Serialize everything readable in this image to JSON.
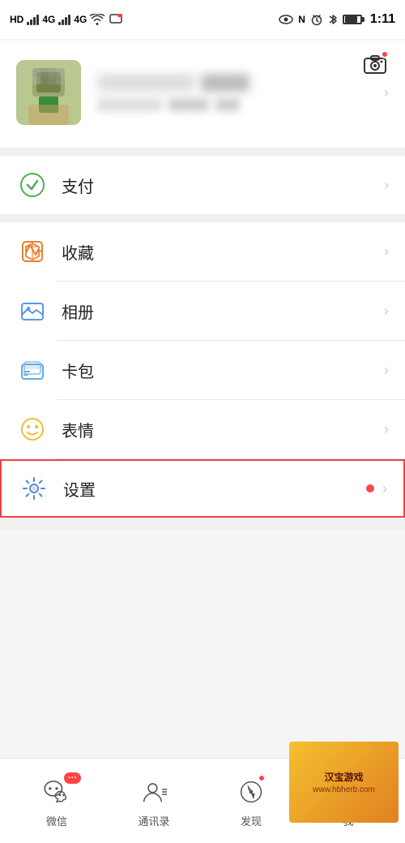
{
  "statusBar": {
    "network": "HD 4G",
    "signal1": "46",
    "signal2": "46",
    "time": "1:11",
    "icons": [
      "eye",
      "notification",
      "alarm",
      "bluetooth",
      "battery"
    ]
  },
  "profile": {
    "cameraLabel": "相机",
    "nameBlurred": true
  },
  "menuItems": [
    {
      "id": "payment",
      "label": "支付",
      "iconType": "payment",
      "highlighted": false,
      "badge": false
    },
    {
      "id": "favorites",
      "label": "收藏",
      "iconType": "favorites",
      "highlighted": false,
      "badge": false
    },
    {
      "id": "photos",
      "label": "相册",
      "iconType": "photos",
      "highlighted": false,
      "badge": false
    },
    {
      "id": "cards",
      "label": "卡包",
      "iconType": "cards",
      "highlighted": false,
      "badge": false
    },
    {
      "id": "emoji",
      "label": "表情",
      "iconType": "emoji",
      "highlighted": false,
      "badge": false
    },
    {
      "id": "settings",
      "label": "设置",
      "iconType": "settings",
      "highlighted": true,
      "badge": true
    }
  ],
  "bottomNav": [
    {
      "id": "wechat",
      "label": "微信",
      "iconType": "wechat",
      "dotType": "ellipsis"
    },
    {
      "id": "contacts",
      "label": "通讯录",
      "iconType": "contacts",
      "dotType": "none"
    },
    {
      "id": "discover",
      "label": "发现",
      "iconType": "discover",
      "dotType": "small"
    },
    {
      "id": "me",
      "label": "我",
      "iconType": "me",
      "dotType": "new",
      "hasWatermark": true
    }
  ],
  "watermark": {
    "text": "汉宝游戏",
    "url": "www.hbherb.com"
  }
}
